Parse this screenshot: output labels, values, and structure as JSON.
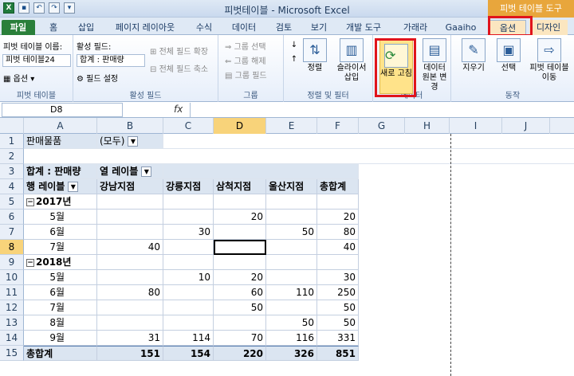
{
  "window": {
    "title": "피벗테이블 - Microsoft Excel",
    "context_tools_title": "피벗 테이블 도구"
  },
  "tabs": [
    "파일",
    "홈",
    "삽입",
    "페이지 레이아웃",
    "수식",
    "데이터",
    "검토",
    "보기",
    "개발 도구",
    "가래라",
    "Gaaiho",
    "옵션",
    "디자인"
  ],
  "ribbon": {
    "pivot_table_group": {
      "name_label": "피벗 테이블 이름:",
      "name_value": "피벗 테이블24",
      "options_label": "옵션",
      "group_label": "피벗 테이블"
    },
    "active_field_group": {
      "field_label": "활성 필드:",
      "field_value": "합계 : 판매량",
      "expand_label": "전체 필드 확장",
      "collapse_label": "전체 필드 축소",
      "settings_label": "필드 설정",
      "group_label": "활성 필드"
    },
    "group_group": {
      "select_label": "그룹 선택",
      "ungroup_label": "그룹 해제",
      "field_label": "그룹 필드",
      "group_label": "그룹"
    },
    "sort_filter_group": {
      "sort_label": "정렬",
      "slicer_label": "슬라이서 삽입",
      "group_label": "정렬 및 필터"
    },
    "data_group": {
      "refresh_label": "새로 고침",
      "change_source_label": "데이터 원본 변경",
      "group_label": "데이터"
    },
    "actions_group": {
      "clear_label": "지우기",
      "select_label": "선택",
      "move_label": "피벗 테이블 이동",
      "group_label": "동작"
    }
  },
  "formula_bar": {
    "name_box": "D8",
    "fx": "fx",
    "formula": ""
  },
  "grid": {
    "columns": [
      "A",
      "B",
      "C",
      "D",
      "E",
      "F",
      "G",
      "H",
      "I",
      "J"
    ],
    "selected_column": "D",
    "selected_row": "8",
    "rows": [
      "1",
      "2",
      "3",
      "4",
      "5",
      "6",
      "7",
      "8",
      "9",
      "10",
      "11",
      "12",
      "13",
      "14",
      "15"
    ],
    "filter": {
      "label": "판매물품",
      "value": "(모두)"
    },
    "pivot_header": {
      "sum_label": "합계 : 판매량",
      "col_labels": "열 레이블"
    },
    "header_row": [
      "행 레이블",
      "강남지점",
      "강릉지점",
      "삼척지점",
      "울산지점",
      "총합계"
    ],
    "body": [
      [
        "2017년",
        "",
        "",
        "",
        "",
        ""
      ],
      [
        "5월",
        "",
        "",
        "20",
        "",
        "20"
      ],
      [
        "6월",
        "",
        "30",
        "",
        "50",
        "80"
      ],
      [
        "7월",
        "40",
        "",
        "",
        "",
        "40"
      ],
      [
        "2018년",
        "",
        "",
        "",
        "",
        ""
      ],
      [
        "5월",
        "",
        "10",
        "20",
        "",
        "30"
      ],
      [
        "6월",
        "80",
        "",
        "60",
        "110",
        "250"
      ],
      [
        "7월",
        "",
        "",
        "50",
        "",
        "50"
      ],
      [
        "8월",
        "",
        "",
        "",
        "50",
        "50"
      ],
      [
        "9월",
        "31",
        "114",
        "70",
        "116",
        "331"
      ]
    ],
    "total_row": [
      "총합계",
      "151",
      "154",
      "220",
      "326",
      "851"
    ]
  }
}
